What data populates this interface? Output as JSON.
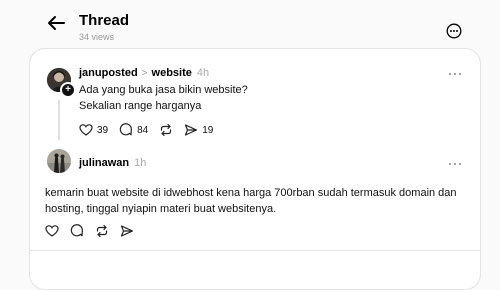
{
  "header": {
    "title": "Thread",
    "views": "34 views"
  },
  "post": {
    "username": "januposted",
    "separator": ">",
    "topic": "website",
    "time": "4h",
    "line1": "Ada yang buka jasa bikin website?",
    "line2": "Sekalian range harganya",
    "likes": "39",
    "comments": "84",
    "shares": "19"
  },
  "reply": {
    "username": "julinawan",
    "time": "1h",
    "text": "kemarin buat website di idwebhost kena harga 700rban sudah termasuk domain dan hosting, tinggal nyiapin materi buat websitenya."
  },
  "icons": {
    "back": "arrow-left-icon",
    "more": "more-circle-icon",
    "like": "heart-icon",
    "comment": "comment-icon",
    "repost": "repost-icon",
    "share": "send-icon"
  }
}
